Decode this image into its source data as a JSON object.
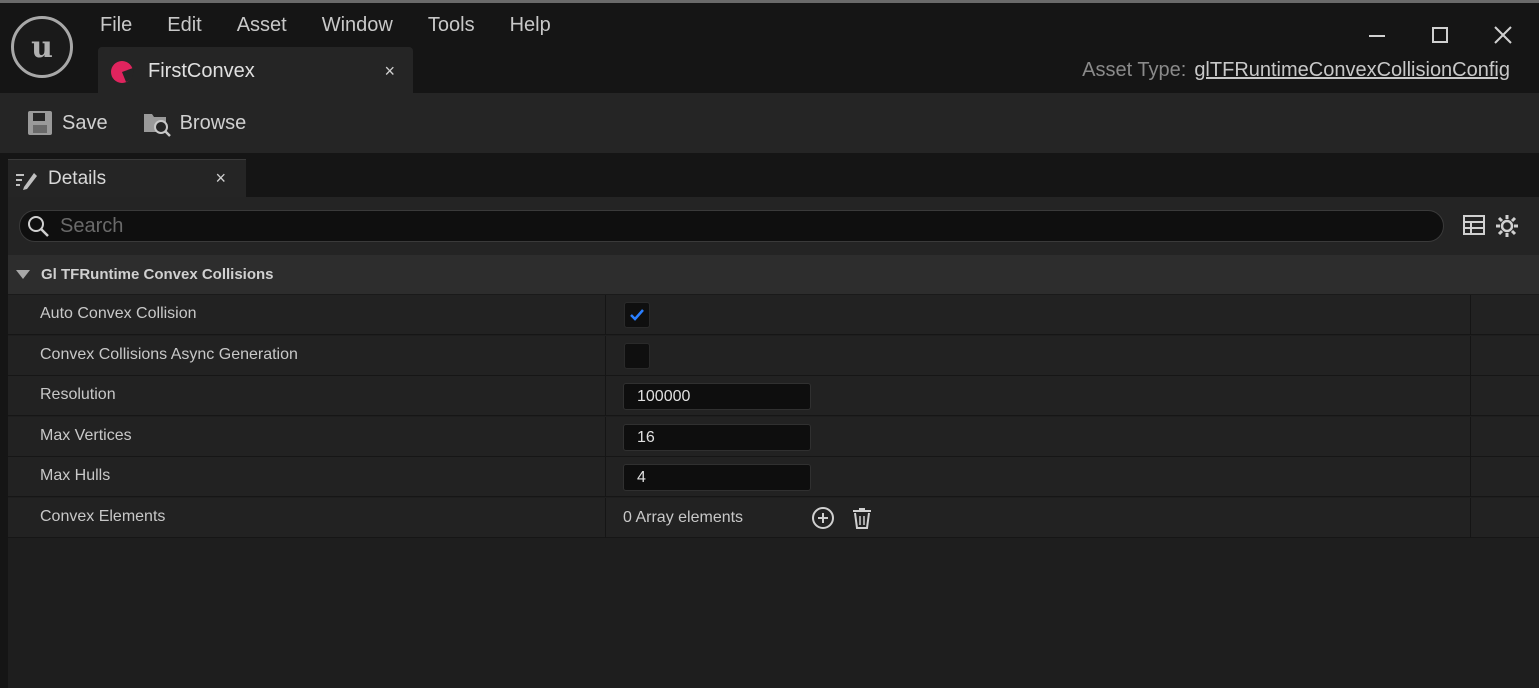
{
  "window": {
    "menu": [
      "File",
      "Edit",
      "Asset",
      "Window",
      "Tools",
      "Help"
    ],
    "controls": {
      "minimize_icon": "minimize-icon",
      "maximize_icon": "maximize-icon",
      "close_icon": "close-icon"
    }
  },
  "tab": {
    "label": "FirstConvex",
    "close": "×",
    "icon": "asset-icon",
    "icon_color": "#e0245e"
  },
  "asset_type": {
    "label": "Asset Type:",
    "value": "glTFRuntimeConvexCollisionConfig"
  },
  "toolbar": {
    "save_label": "Save",
    "browse_label": "Browse"
  },
  "details": {
    "tab_label": "Details",
    "close": "×",
    "search_placeholder": "Search",
    "category": "Gl TFRuntime Convex Collisions",
    "properties": [
      {
        "name": "Auto Convex Collision",
        "type": "checkbox",
        "checked": true
      },
      {
        "name": "Convex Collisions Async Generation",
        "type": "checkbox",
        "checked": false
      },
      {
        "name": "Resolution",
        "type": "number",
        "value": "100000"
      },
      {
        "name": "Max Vertices",
        "type": "number",
        "value": "16"
      },
      {
        "name": "Max Hulls",
        "type": "number",
        "value": "4"
      },
      {
        "name": "Convex Elements",
        "type": "array",
        "value": "0 Array elements"
      }
    ]
  },
  "colors": {
    "accent_blue": "#2a7fff",
    "background": "#151515",
    "panel": "#242424"
  }
}
